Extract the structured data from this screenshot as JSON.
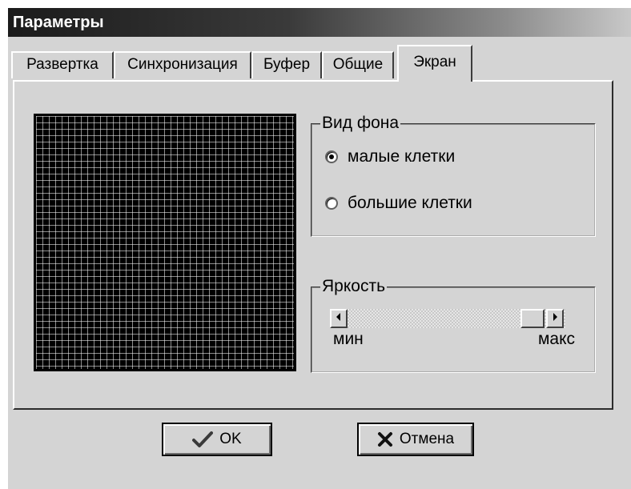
{
  "window": {
    "title": "Параметры"
  },
  "tabs": [
    {
      "label": "Развертка"
    },
    {
      "label": "Синхронизация"
    },
    {
      "label": "Буфер"
    },
    {
      "label": "Общие"
    },
    {
      "label": "Экран",
      "active": true
    }
  ],
  "background_group": {
    "title": "Вид фона",
    "options": [
      {
        "label": "малые клетки",
        "selected": true
      },
      {
        "label": "большие клетки",
        "selected": false
      }
    ]
  },
  "brightness_group": {
    "title": "Яркость",
    "min_label": "мин",
    "max_label": "макс",
    "level_fraction": 0.9
  },
  "buttons": {
    "ok_label": "OK",
    "cancel_label": "Отмена"
  },
  "icons": {
    "ok": "checkmark-icon",
    "cancel": "x-icon",
    "scroll_left": "arrow-left-icon",
    "scroll_right": "arrow-right-icon"
  },
  "colors": {
    "dialog_bg": "#d4d4d4",
    "preview_bg": "#000000",
    "grid_dots": "#ffffff",
    "title_bar": "#1b1b1b"
  }
}
